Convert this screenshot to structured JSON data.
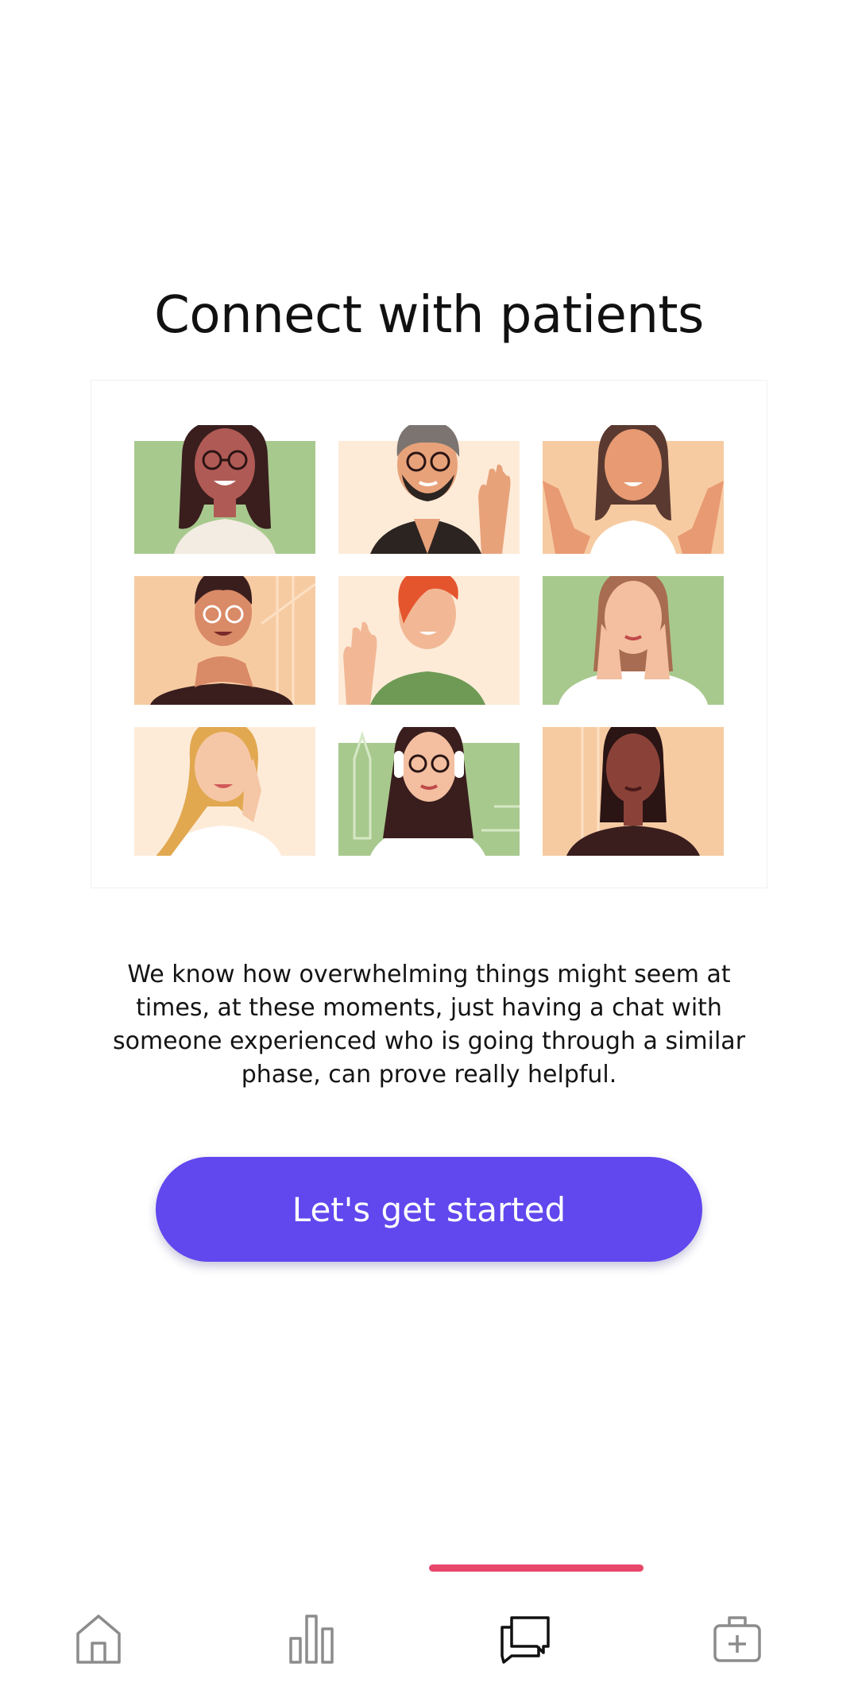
{
  "page": {
    "title": "Connect with patients",
    "description": "We know how overwhelming things might seem at times, at these moments, just having a chat with someone experienced who is going through a similar phase, can prove really helpful.",
    "cta_label": "Let's get started"
  },
  "colors": {
    "accent": "#6047EE",
    "nav_indicator": "#E8476A",
    "tile_green": "#A8C98E",
    "tile_peach": "#F7CBA2",
    "tile_cream": "#FDEBD8"
  },
  "illustration": {
    "tiles": [
      {
        "person": "woman-glasses-green",
        "bg": "green"
      },
      {
        "person": "man-glasses-beard-waving",
        "bg": "cream"
      },
      {
        "person": "woman-waving-both-hands",
        "bg": "peach"
      },
      {
        "person": "woman-earphones-laughing",
        "bg": "peach"
      },
      {
        "person": "redhead-waving",
        "bg": "cream"
      },
      {
        "person": "woman-hands-on-cheeks",
        "bg": "green"
      },
      {
        "person": "blonde-woman-smiling",
        "bg": "cream"
      },
      {
        "person": "woman-headphones-glasses",
        "bg": "green"
      },
      {
        "person": "woman-braids-earbuds",
        "bg": "peach"
      }
    ]
  },
  "bottom_nav": {
    "active_index": 2,
    "items": [
      {
        "icon": "home-icon"
      },
      {
        "icon": "bar-chart-icon"
      },
      {
        "icon": "chat-icon"
      },
      {
        "icon": "medical-kit-icon"
      }
    ]
  }
}
